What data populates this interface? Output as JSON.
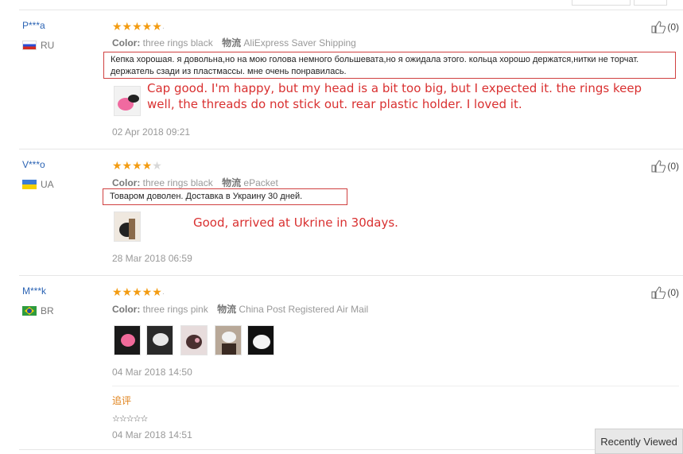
{
  "reviews": [
    {
      "user": "P***a",
      "country": "RU",
      "stars": 5,
      "color_label": "Color:",
      "color_value": "three rings black",
      "shipping_label": "物流",
      "shipping_value": "AliExpress Saver Shipping",
      "text": "Кепка хорошая. я довольна,но на мою голова немного большевата,но я ожидала этого. кольца хорошо держатся,нитки не торчат. держатель сзади из пластмассы. мне очень понравилась.",
      "translation": "Cap good. I'm happy, but my head is a bit too big, but I expected it. the rings keep well, the threads do not stick out. rear plastic holder. I loved it.",
      "date": "02 Apr 2018 09:21",
      "likes": "(0)"
    },
    {
      "user": "V***o",
      "country": "UA",
      "stars": 4,
      "color_label": "Color:",
      "color_value": "three rings black",
      "shipping_label": "物流",
      "shipping_value": "ePacket",
      "text": "Товаром доволен. Доставка в Украину 30 дней.",
      "translation": "Good, arrived at Ukrine in 30days.",
      "date": "28 Mar 2018 06:59",
      "likes": "(0)"
    },
    {
      "user": "M***k",
      "country": "BR",
      "stars": 5,
      "color_label": "Color:",
      "color_value": "three rings pink",
      "shipping_label": "物流",
      "shipping_value": "China Post Registered Air Mail",
      "date": "04 Mar 2018 14:50",
      "likes": "(0)",
      "followup_label": "追评",
      "followup_text": "☆☆☆☆☆",
      "followup_date": "04 Mar 2018 14:51"
    }
  ],
  "recently_viewed": "Recently Viewed",
  "colors": {
    "accent_star": "#f39c12",
    "username": "#2c64b4",
    "annotation_red": "#d93030",
    "followup": "#e0821a"
  }
}
